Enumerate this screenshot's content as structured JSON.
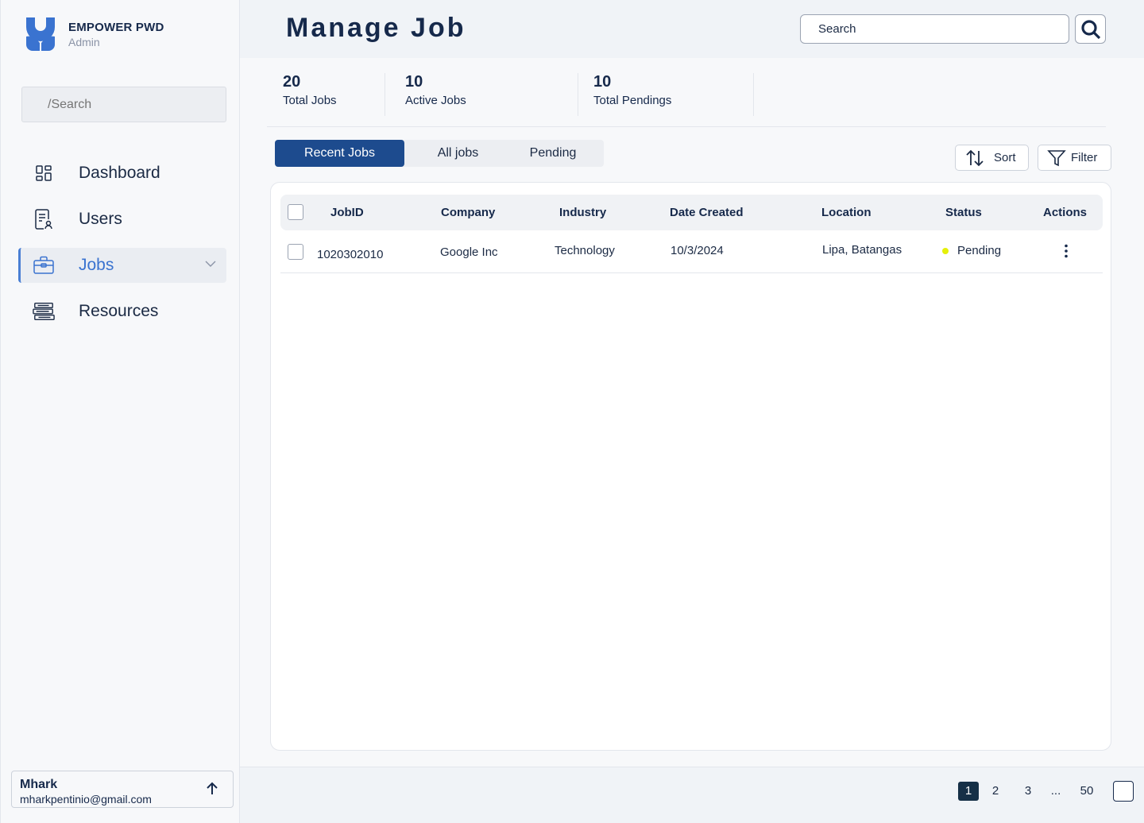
{
  "brand": {
    "name": "EMPOWER PWD",
    "role": "Admin"
  },
  "sidebar": {
    "search_placeholder": "/Search",
    "items": [
      {
        "label": "Dashboard",
        "icon": "dashboard-grid-icon"
      },
      {
        "label": "Users",
        "icon": "user-document-icon"
      },
      {
        "label": "Jobs",
        "icon": "briefcase-icon",
        "active": true
      },
      {
        "label": "Resources",
        "icon": "books-stack-icon"
      }
    ]
  },
  "user": {
    "name": "Mhark",
    "email": "mharkpentinio@gmail.com"
  },
  "header": {
    "title": "Manage Job",
    "search_placeholder": "Search"
  },
  "stats": [
    {
      "value": "20",
      "label": "Total Jobs"
    },
    {
      "value": "10",
      "label": "Active Jobs"
    },
    {
      "value": "10",
      "label": "Total Pendings"
    }
  ],
  "tabs": [
    {
      "label": "Recent Jobs",
      "active": true
    },
    {
      "label": "All jobs"
    },
    {
      "label": "Pending"
    }
  ],
  "toolbar": {
    "sort_label": "Sort",
    "filter_label": "Filter"
  },
  "table": {
    "headers": [
      "JobID",
      "Company",
      "Industry",
      "Date Created",
      "Location",
      "Status",
      "Actions"
    ],
    "rows": [
      {
        "job_id": "1020302010",
        "company": "Google Inc",
        "industry": "Technology",
        "date_created": "10/3/2024",
        "location": "Lipa, Batangas",
        "status": "Pending"
      }
    ]
  },
  "pagination": {
    "pages": [
      "1",
      "2",
      "3",
      "...",
      "50"
    ],
    "current": "1"
  },
  "colors": {
    "primary": "#1d4b8e",
    "accent": "#3a73d0",
    "pending": "#e5f00a",
    "pagination_active": "#163047"
  }
}
